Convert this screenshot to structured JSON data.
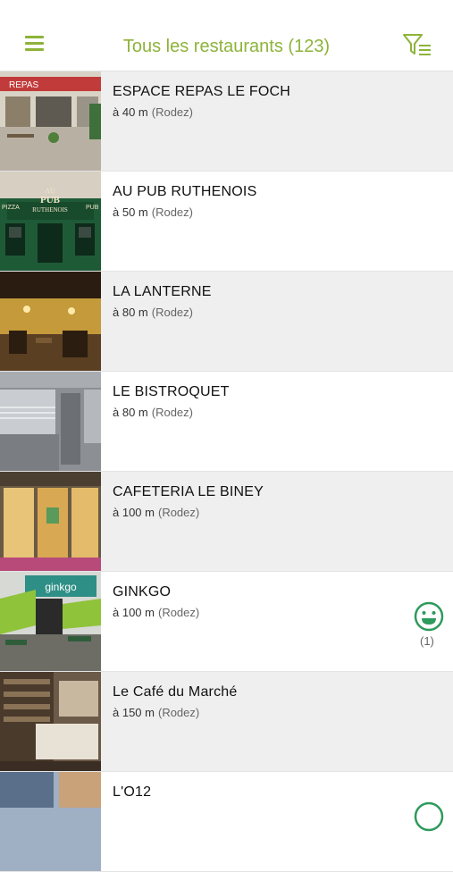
{
  "header": {
    "title": "Tous les restaurants (123)",
    "menu_icon": "hamburger-menu-icon",
    "filter_icon": "filter-list-icon",
    "accent_color": "#8db33a"
  },
  "restaurants": [
    {
      "name": "ESPACE REPAS LE FOCH",
      "distance": "à 40 m",
      "city": "(Rodez)"
    },
    {
      "name": "AU PUB RUTHENOIS",
      "distance": "à 50 m",
      "city": "(Rodez)"
    },
    {
      "name": "LA LANTERNE",
      "distance": "à 80 m",
      "city": "(Rodez)"
    },
    {
      "name": "LE BISTROQUET",
      "distance": "à 80 m",
      "city": "(Rodez)"
    },
    {
      "name": "CAFETERIA LE BINEY",
      "distance": "à 100 m",
      "city": "(Rodez)"
    },
    {
      "name": "GINKGO",
      "distance": "à 100 m",
      "city": "(Rodez)",
      "rating_icon": "smiley-icon",
      "rating_count": "(1)"
    },
    {
      "name": "Le Café du Marché",
      "distance": "à 150 m",
      "city": "(Rodez)"
    },
    {
      "name": "L'O12",
      "distance": "",
      "city": ""
    }
  ],
  "photo_texts": {
    "espace_sign": "REPAS",
    "pub_sign_top": "AU",
    "pub_sign_mid": "PUB",
    "pub_sign_bottom": "RUTHENOIS",
    "pub_pizza_left": "PIZZA",
    "pub_pizza_right": "PUB",
    "ginkgo_sign": "ginkgo"
  }
}
